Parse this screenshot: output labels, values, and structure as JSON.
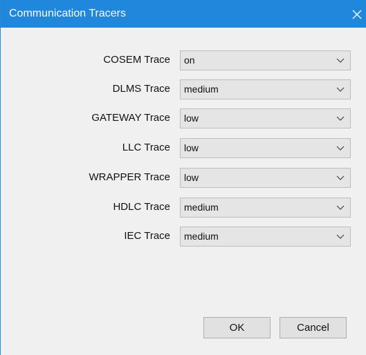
{
  "window": {
    "title": "Communication Tracers",
    "close_icon": "close-icon",
    "accent_color": "#1f88dd"
  },
  "traces": [
    {
      "label": "COSEM Trace",
      "value": "on"
    },
    {
      "label": "DLMS Trace",
      "value": "medium"
    },
    {
      "label": "GATEWAY Trace",
      "value": "low"
    },
    {
      "label": "LLC Trace",
      "value": "low"
    },
    {
      "label": "WRAPPER Trace",
      "value": "low"
    },
    {
      "label": "HDLC Trace",
      "value": "medium"
    },
    {
      "label": "IEC Trace",
      "value": "medium"
    }
  ],
  "buttons": {
    "ok_label": "OK",
    "cancel_label": "Cancel"
  }
}
